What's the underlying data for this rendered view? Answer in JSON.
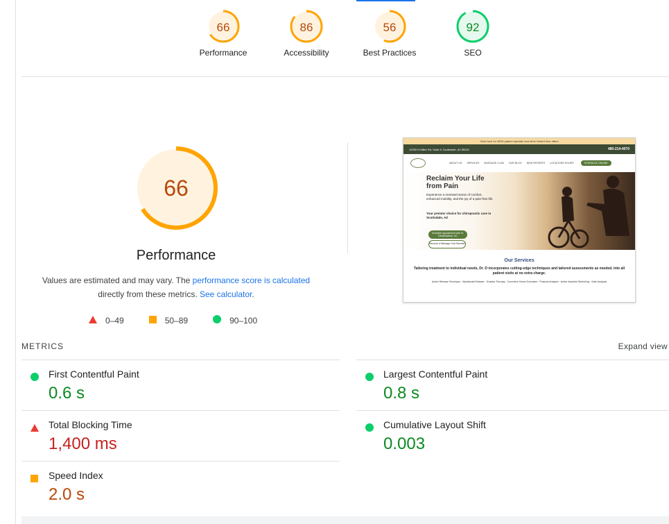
{
  "summary": {
    "gauges": [
      {
        "score": "66",
        "label": "Performance",
        "status": "average"
      },
      {
        "score": "86",
        "label": "Accessibility",
        "status": "average"
      },
      {
        "score": "56",
        "label": "Best Practices",
        "status": "average"
      },
      {
        "score": "92",
        "label": "SEO",
        "status": "pass"
      }
    ]
  },
  "performance": {
    "score": "66",
    "title": "Performance",
    "desc_before": "Values are estimated and may vary. The ",
    "link_score": "performance score is calculated",
    "desc_middle": " directly from these metrics. ",
    "link_calc": "See calculator",
    "desc_after": "."
  },
  "legend": {
    "fail": "0–49",
    "average": "50–89",
    "pass": "90–100"
  },
  "thumbnail": {
    "banner": "Click here for NEW patient specials and other limited time offers",
    "address": "10250 N Miller Rd, Suite 6, Scottsdale, AZ 85201",
    "phone": "480-214-4070",
    "nav": [
      "ABOUT US",
      "SERVICES",
      "MASSAGE CLUB",
      "OUR BLOG",
      "NEW PATIENTS",
      "LOCATIONS HOURS"
    ],
    "nav_button": "SCHEDULE ONLINE",
    "hero_title": "Reclaim Your Life from Pain",
    "hero_p1": "Experience a renewed sense of comfort, enhanced mobility, and the joy of a pain-free life.",
    "hero_p2": "Your premier choice for chiropractic care in Scottsdale, AZ",
    "btn1": "Schedule Appointment with Dr. Desafinadhan, DC",
    "btn2": "Become a Massage Club Member",
    "services_title": "Our Services",
    "services_desc": "Tailoring treatment to individual needs, Dr. D incorporates cutting-edge techniques and tailored assessments as needed, into all patient visits at no extra charge.",
    "services_tags": "Active Release Technique · Myofascial Release · Guasha Therapy · Corrective Home Exercises · Postural Analysis · Active Assisted Stretching · Gate Analysis"
  },
  "metrics": {
    "heading": "METRICS",
    "expand": "Expand view",
    "items": [
      {
        "name": "First Contentful Paint",
        "value": "0.6 s",
        "status": "pass"
      },
      {
        "name": "Largest Contentful Paint",
        "value": "0.8 s",
        "status": "pass"
      },
      {
        "name": "Total Blocking Time",
        "value": "1,400 ms",
        "status": "fail"
      },
      {
        "name": "Cumulative Layout Shift",
        "value": "0.003",
        "status": "pass"
      },
      {
        "name": "Speed Index",
        "value": "2.0 s",
        "status": "average"
      }
    ]
  },
  "colors": {
    "pass": "#0cce6b",
    "average": "#ffa400",
    "fail": "#ff4e42",
    "pass_text": "#0a8a21",
    "average_text": "#b8480a",
    "fail_text": "#c5221f",
    "link": "#1a73e8"
  }
}
